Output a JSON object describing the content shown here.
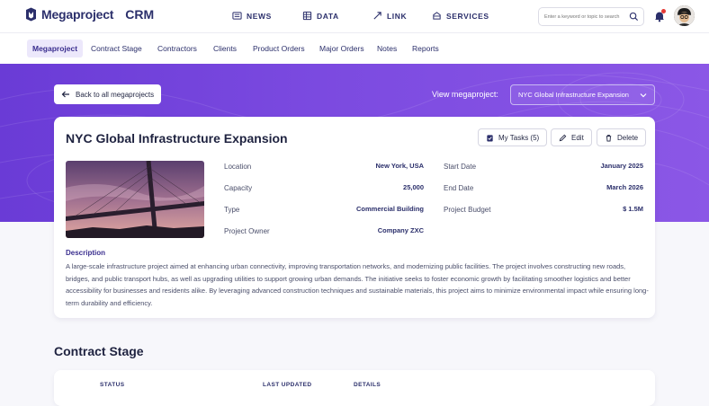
{
  "app": {
    "brand": "Megaproject",
    "crm": "CRM"
  },
  "mainnav": [
    {
      "label": "NEWS",
      "icon": "newspaper-icon"
    },
    {
      "label": "DATA",
      "icon": "data-icon"
    },
    {
      "label": "LINK",
      "icon": "link-icon"
    },
    {
      "label": "SERVICES",
      "icon": "services-icon"
    }
  ],
  "search": {
    "placeholder": "Enter a keyword or topic to search"
  },
  "subnav": [
    "Megaproject",
    "Contract Stage",
    "Contractors",
    "Clients",
    "Product Orders",
    "Major Orders",
    "Notes",
    "Reports"
  ],
  "hero": {
    "back_label": "Back to all megaprojects",
    "view_label": "View megaproject:",
    "view_selected": "NYC Global Infrastructure Expansion"
  },
  "project": {
    "title": "NYC Global Infrastructure Expansion",
    "actions": {
      "tasks": "My Tasks (5)",
      "edit": "Edit",
      "delete": "Delete"
    },
    "fields_left": [
      {
        "label": "Location",
        "value": "New York, USA"
      },
      {
        "label": "Capacity",
        "value": "25,000"
      },
      {
        "label": "Type",
        "value": "Commercial Building"
      },
      {
        "label": "Project Owner",
        "value": "Company ZXC"
      }
    ],
    "fields_right": [
      {
        "label": "Start Date",
        "value": "January 2025"
      },
      {
        "label": "End Date",
        "value": "March 2026"
      },
      {
        "label": "Project Budget",
        "value": "$ 1.5M"
      }
    ],
    "description_title": "Description",
    "description": "A large-scale infrastructure project aimed at enhancing urban connectivity, improving transportation networks, and modernizing public facilities. The project involves constructing new roads, bridges, and public transport hubs, as well as upgrading utilities to support growing urban demands. The initiative seeks to foster economic growth by facilitating smoother logistics and better accessibility for businesses and residents alike. By leveraging advanced construction techniques and sustainable materials, this project aims to minimize environmental impact while ensuring long-term durability and efficiency."
  },
  "contract": {
    "title": "Contract Stage",
    "columns": [
      "STATUS",
      "LAST UPDATED",
      "DETAILS"
    ]
  },
  "colors": {
    "accent": "#6a3bd6",
    "navy": "#2b2f6b",
    "alert": "#e53935"
  }
}
